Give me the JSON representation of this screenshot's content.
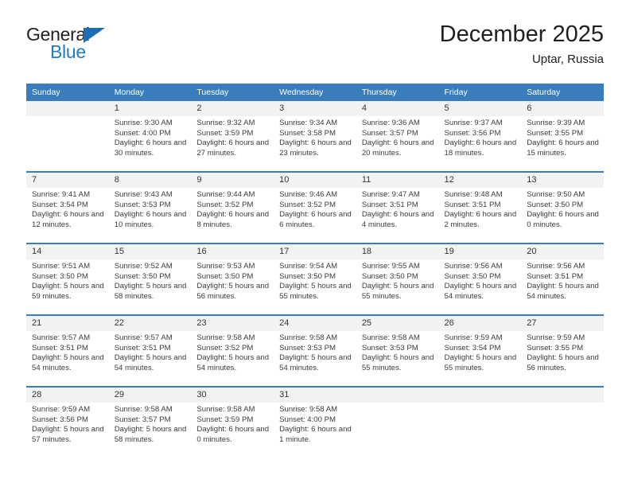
{
  "brand": {
    "name_part1": "General",
    "name_part2": "Blue",
    "triangle_color": "#1b6fb5",
    "blue_color": "#1d7cc6"
  },
  "header": {
    "title": "December 2025",
    "location": "Uptar, Russia",
    "header_bg": "#3a7dbd",
    "daynum_bg": "#f2f2f2"
  },
  "weekdays": [
    "Sunday",
    "Monday",
    "Tuesday",
    "Wednesday",
    "Thursday",
    "Friday",
    "Saturday"
  ],
  "weeks": [
    [
      {
        "day": "",
        "sunrise": "",
        "sunset": "",
        "daylight": ""
      },
      {
        "day": "1",
        "sunrise": "Sunrise: 9:30 AM",
        "sunset": "Sunset: 4:00 PM",
        "daylight": "Daylight: 6 hours and 30 minutes."
      },
      {
        "day": "2",
        "sunrise": "Sunrise: 9:32 AM",
        "sunset": "Sunset: 3:59 PM",
        "daylight": "Daylight: 6 hours and 27 minutes."
      },
      {
        "day": "3",
        "sunrise": "Sunrise: 9:34 AM",
        "sunset": "Sunset: 3:58 PM",
        "daylight": "Daylight: 6 hours and 23 minutes."
      },
      {
        "day": "4",
        "sunrise": "Sunrise: 9:36 AM",
        "sunset": "Sunset: 3:57 PM",
        "daylight": "Daylight: 6 hours and 20 minutes."
      },
      {
        "day": "5",
        "sunrise": "Sunrise: 9:37 AM",
        "sunset": "Sunset: 3:56 PM",
        "daylight": "Daylight: 6 hours and 18 minutes."
      },
      {
        "day": "6",
        "sunrise": "Sunrise: 9:39 AM",
        "sunset": "Sunset: 3:55 PM",
        "daylight": "Daylight: 6 hours and 15 minutes."
      }
    ],
    [
      {
        "day": "7",
        "sunrise": "Sunrise: 9:41 AM",
        "sunset": "Sunset: 3:54 PM",
        "daylight": "Daylight: 6 hours and 12 minutes."
      },
      {
        "day": "8",
        "sunrise": "Sunrise: 9:43 AM",
        "sunset": "Sunset: 3:53 PM",
        "daylight": "Daylight: 6 hours and 10 minutes."
      },
      {
        "day": "9",
        "sunrise": "Sunrise: 9:44 AM",
        "sunset": "Sunset: 3:52 PM",
        "daylight": "Daylight: 6 hours and 8 minutes."
      },
      {
        "day": "10",
        "sunrise": "Sunrise: 9:46 AM",
        "sunset": "Sunset: 3:52 PM",
        "daylight": "Daylight: 6 hours and 6 minutes."
      },
      {
        "day": "11",
        "sunrise": "Sunrise: 9:47 AM",
        "sunset": "Sunset: 3:51 PM",
        "daylight": "Daylight: 6 hours and 4 minutes."
      },
      {
        "day": "12",
        "sunrise": "Sunrise: 9:48 AM",
        "sunset": "Sunset: 3:51 PM",
        "daylight": "Daylight: 6 hours and 2 minutes."
      },
      {
        "day": "13",
        "sunrise": "Sunrise: 9:50 AM",
        "sunset": "Sunset: 3:50 PM",
        "daylight": "Daylight: 6 hours and 0 minutes."
      }
    ],
    [
      {
        "day": "14",
        "sunrise": "Sunrise: 9:51 AM",
        "sunset": "Sunset: 3:50 PM",
        "daylight": "Daylight: 5 hours and 59 minutes."
      },
      {
        "day": "15",
        "sunrise": "Sunrise: 9:52 AM",
        "sunset": "Sunset: 3:50 PM",
        "daylight": "Daylight: 5 hours and 58 minutes."
      },
      {
        "day": "16",
        "sunrise": "Sunrise: 9:53 AM",
        "sunset": "Sunset: 3:50 PM",
        "daylight": "Daylight: 5 hours and 56 minutes."
      },
      {
        "day": "17",
        "sunrise": "Sunrise: 9:54 AM",
        "sunset": "Sunset: 3:50 PM",
        "daylight": "Daylight: 5 hours and 55 minutes."
      },
      {
        "day": "18",
        "sunrise": "Sunrise: 9:55 AM",
        "sunset": "Sunset: 3:50 PM",
        "daylight": "Daylight: 5 hours and 55 minutes."
      },
      {
        "day": "19",
        "sunrise": "Sunrise: 9:56 AM",
        "sunset": "Sunset: 3:50 PM",
        "daylight": "Daylight: 5 hours and 54 minutes."
      },
      {
        "day": "20",
        "sunrise": "Sunrise: 9:56 AM",
        "sunset": "Sunset: 3:51 PM",
        "daylight": "Daylight: 5 hours and 54 minutes."
      }
    ],
    [
      {
        "day": "21",
        "sunrise": "Sunrise: 9:57 AM",
        "sunset": "Sunset: 3:51 PM",
        "daylight": "Daylight: 5 hours and 54 minutes."
      },
      {
        "day": "22",
        "sunrise": "Sunrise: 9:57 AM",
        "sunset": "Sunset: 3:51 PM",
        "daylight": "Daylight: 5 hours and 54 minutes."
      },
      {
        "day": "23",
        "sunrise": "Sunrise: 9:58 AM",
        "sunset": "Sunset: 3:52 PM",
        "daylight": "Daylight: 5 hours and 54 minutes."
      },
      {
        "day": "24",
        "sunrise": "Sunrise: 9:58 AM",
        "sunset": "Sunset: 3:53 PM",
        "daylight": "Daylight: 5 hours and 54 minutes."
      },
      {
        "day": "25",
        "sunrise": "Sunrise: 9:58 AM",
        "sunset": "Sunset: 3:53 PM",
        "daylight": "Daylight: 5 hours and 55 minutes."
      },
      {
        "day": "26",
        "sunrise": "Sunrise: 9:59 AM",
        "sunset": "Sunset: 3:54 PM",
        "daylight": "Daylight: 5 hours and 55 minutes."
      },
      {
        "day": "27",
        "sunrise": "Sunrise: 9:59 AM",
        "sunset": "Sunset: 3:55 PM",
        "daylight": "Daylight: 5 hours and 56 minutes."
      }
    ],
    [
      {
        "day": "28",
        "sunrise": "Sunrise: 9:59 AM",
        "sunset": "Sunset: 3:56 PM",
        "daylight": "Daylight: 5 hours and 57 minutes."
      },
      {
        "day": "29",
        "sunrise": "Sunrise: 9:58 AM",
        "sunset": "Sunset: 3:57 PM",
        "daylight": "Daylight: 5 hours and 58 minutes."
      },
      {
        "day": "30",
        "sunrise": "Sunrise: 9:58 AM",
        "sunset": "Sunset: 3:59 PM",
        "daylight": "Daylight: 6 hours and 0 minutes."
      },
      {
        "day": "31",
        "sunrise": "Sunrise: 9:58 AM",
        "sunset": "Sunset: 4:00 PM",
        "daylight": "Daylight: 6 hours and 1 minute."
      },
      {
        "day": "",
        "sunrise": "",
        "sunset": "",
        "daylight": ""
      },
      {
        "day": "",
        "sunrise": "",
        "sunset": "",
        "daylight": ""
      },
      {
        "day": "",
        "sunrise": "",
        "sunset": "",
        "daylight": ""
      }
    ]
  ]
}
